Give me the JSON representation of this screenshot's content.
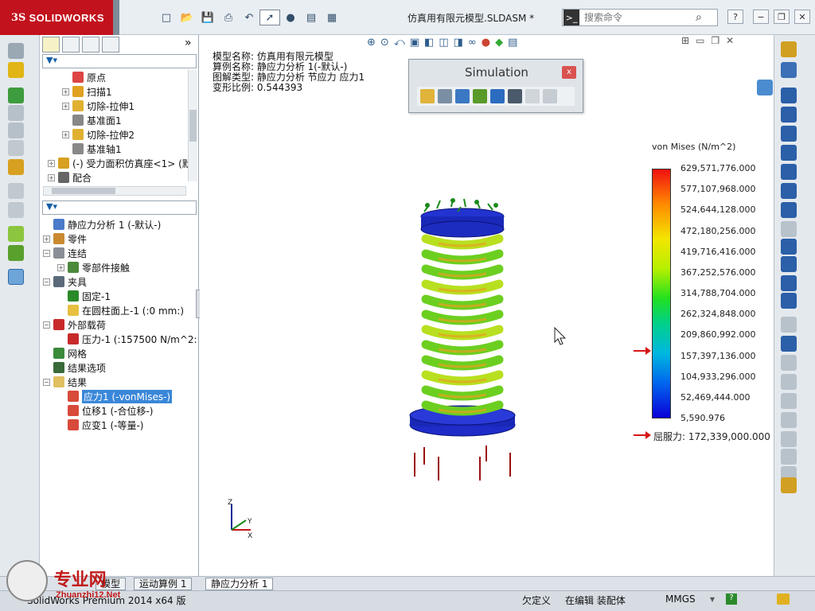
{
  "app": {
    "brand": "SOLIDWORKS",
    "ds_mark": "3S",
    "doc_title": "仿真用有限元模型.SLDASM *"
  },
  "search": {
    "placeholder": "搜索命令"
  },
  "window_buttons": {
    "minimize": "−",
    "restore": "❐",
    "close": "✕",
    "help": "?"
  },
  "panel": {
    "collapse": "»"
  },
  "feature_tree": [
    {
      "label": "原点",
      "icon": "origin-icon",
      "indent": 1,
      "expander": ""
    },
    {
      "label": "扫描1",
      "icon": "sweep-icon",
      "indent": 1,
      "expander": "+"
    },
    {
      "label": "切除-拉伸1",
      "icon": "cut-extrude-icon",
      "indent": 1,
      "expander": "+"
    },
    {
      "label": "基准面1",
      "icon": "plane-icon",
      "indent": 1,
      "expander": ""
    },
    {
      "label": "切除-拉伸2",
      "icon": "cut-extrude-icon",
      "indent": 1,
      "expander": "+"
    },
    {
      "label": "基准轴1",
      "icon": "axis-icon",
      "indent": 1,
      "expander": ""
    },
    {
      "label": "(-) 受力面积仿真座<1> (默",
      "icon": "part-icon",
      "indent": 0,
      "expander": "+"
    },
    {
      "label": "配合",
      "icon": "mate-icon",
      "indent": 0,
      "expander": "+"
    }
  ],
  "sim_tree": [
    {
      "label": "静应力分析 1 (-默认-)",
      "icon": "study-icon",
      "indent": 0,
      "expander": ""
    },
    {
      "label": "零件",
      "icon": "parts-icon",
      "indent": 0,
      "expander": "+"
    },
    {
      "label": "连结",
      "icon": "connections-icon",
      "indent": 0,
      "expander": "−"
    },
    {
      "label": "零部件接触",
      "icon": "contact-icon",
      "indent": 1,
      "expander": "+"
    },
    {
      "label": "夹具",
      "icon": "fixture-icon",
      "indent": 0,
      "expander": "−"
    },
    {
      "label": "固定-1",
      "icon": "fixed-icon",
      "indent": 1,
      "expander": ""
    },
    {
      "label": "在圆柱面上-1 (:0 mm:)",
      "icon": "cylinder-icon",
      "indent": 1,
      "expander": ""
    },
    {
      "label": "外部载荷",
      "icon": "load-icon",
      "indent": 0,
      "expander": "−"
    },
    {
      "label": "压力-1 (:157500 N/m^2:",
      "icon": "pressure-icon",
      "indent": 1,
      "expander": ""
    },
    {
      "label": "网格",
      "icon": "mesh-icon",
      "indent": 0,
      "expander": ""
    },
    {
      "label": "结果选项",
      "icon": "result-options-icon",
      "indent": 0,
      "expander": ""
    },
    {
      "label": "结果",
      "icon": "results-folder-icon",
      "indent": 0,
      "expander": "−"
    },
    {
      "label": "应力1 (-vonMises-)",
      "icon": "stress-plot-icon",
      "indent": 1,
      "expander": "",
      "selected": true
    },
    {
      "label": "位移1 (-合位移-)",
      "icon": "displacement-plot-icon",
      "indent": 1,
      "expander": ""
    },
    {
      "label": "应变1 (-等量-)",
      "icon": "strain-plot-icon",
      "indent": 1,
      "expander": ""
    }
  ],
  "plot_info": {
    "model": "模型名称: 仿真用有限元模型",
    "config": "算例名称: 静应力分析 1(-默认-)",
    "plot_type": "图解类型: 静应力分析 节应力 应力1",
    "scale": "变形比例: 0.544393"
  },
  "sim_toolbar": {
    "title": "Simulation",
    "close": "x"
  },
  "chart_data": {
    "type": "heatmap",
    "title": "von Mises (N/m^2)",
    "ticks": [
      "629,571,776.000",
      "577,107,968.000",
      "524,644,128.000",
      "472,180,256.000",
      "419,716,416.000",
      "367,252,576.000",
      "314,788,704.000",
      "262,324,848.000",
      "209,860,992.000",
      "157,397,136.000",
      "104,933,296.000",
      "52,469,444.000",
      "5,590.976"
    ],
    "max": 629571776.0,
    "min": 5590.976,
    "yield_label": "屈服力: 172,339,000.000",
    "yield_value": 172339000.0,
    "colormap": [
      "#f01010",
      "#ff8a00",
      "#f3e600",
      "#22e020",
      "#00b8e0",
      "#0a00d8"
    ]
  },
  "triad": {
    "x": "X",
    "y": "Y",
    "z": "Z"
  },
  "tabs": [
    "模型",
    "运动算例 1",
    "静应力分析 1"
  ],
  "status": {
    "left": "SolidWorks Premium 2014 x64 版",
    "undefined": "欠定义",
    "editing": "在编辑 装配体",
    "units": "MMGS"
  },
  "watermark": {
    "text": "专业网",
    "sub": "Zhuanzhi12.Net"
  }
}
